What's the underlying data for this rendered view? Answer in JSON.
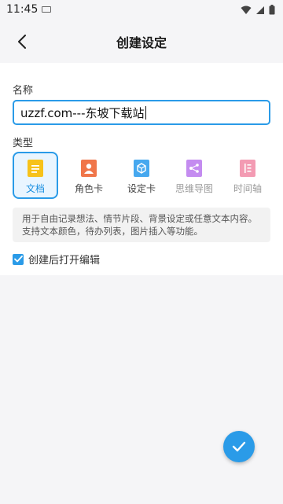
{
  "status_bar": {
    "time": "11:45"
  },
  "header": {
    "title": "创建设定"
  },
  "form": {
    "name_label": "名称",
    "name_value": "uzzf.com---东坡下载站",
    "type_label": "类型",
    "types": [
      {
        "label": "文档",
        "icon": "document-icon",
        "color": "#f7c21a"
      },
      {
        "label": "角色卡",
        "icon": "character-card-icon",
        "color": "#f0764a"
      },
      {
        "label": "设定卡",
        "icon": "setting-card-icon",
        "color": "#46a8ef"
      },
      {
        "label": "思维导图",
        "icon": "mind-map-icon",
        "color": "#c48cf0"
      },
      {
        "label": "时间轴",
        "icon": "timeline-icon",
        "color": "#f39bb3"
      }
    ],
    "selected_type": "文档",
    "description": "用于自由记录想法、情节片段、背景设定或任意文本内容。支持文本颜色，待办列表，图片插入等功能。",
    "open_after_create_label": "创建后打开编辑",
    "open_after_create_checked": true
  },
  "accent_color": "#2a9be8"
}
